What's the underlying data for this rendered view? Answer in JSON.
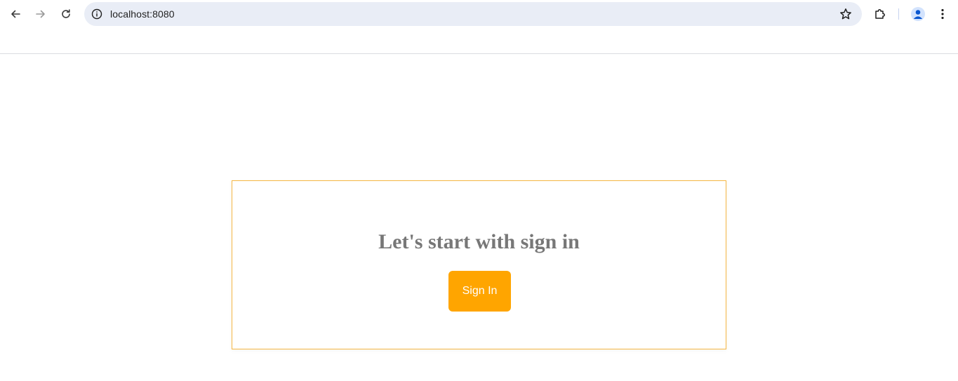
{
  "browser": {
    "url": "localhost:8080",
    "icons": {
      "back": "back-arrow-icon",
      "forward": "forward-arrow-icon",
      "reload": "reload-icon",
      "site_info": "info-icon",
      "bookmark": "star-icon",
      "extensions": "puzzle-icon",
      "profile": "profile-icon",
      "menu": "kebab-menu-icon"
    }
  },
  "main": {
    "title": "Let's start with sign in",
    "sign_in_label": "Sign In"
  },
  "colors": {
    "accent": "#ffa500",
    "card_border": "#f5b642",
    "title_text": "#777777",
    "omnibox_bg": "#e9edf6"
  }
}
